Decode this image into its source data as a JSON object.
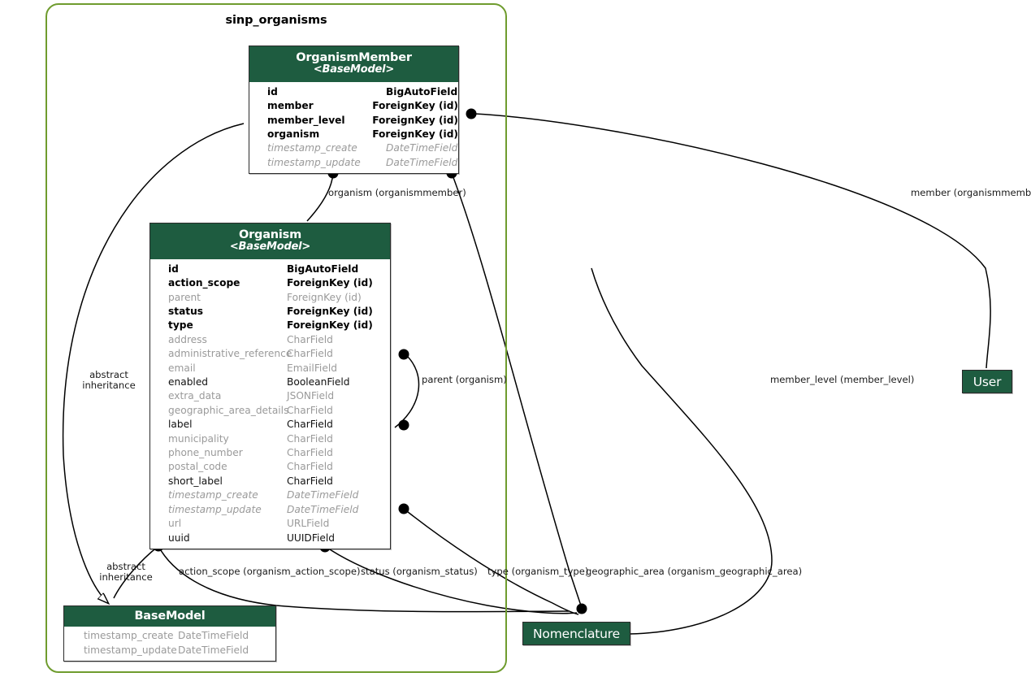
{
  "diagram": {
    "title": "sinp_organisms",
    "cluster_border_color": "#6f9c2e",
    "header_color": "#1e5c40",
    "node_text_color": "#ffffff",
    "edge_color": "#000000"
  },
  "models": [
    {
      "key": "organismmember",
      "name": "OrganismMember",
      "base": "<BaseModel>",
      "fields": [
        {
          "name": "id",
          "type": "BigAutoField",
          "style": "strong"
        },
        {
          "name": "member",
          "type": "ForeignKey (id)",
          "style": "strong"
        },
        {
          "name": "member_level",
          "type": "ForeignKey (id)",
          "style": "strong"
        },
        {
          "name": "organism",
          "type": "ForeignKey (id)",
          "style": "strong"
        },
        {
          "name": "timestamp_create",
          "type": "DateTimeField",
          "style": "italic"
        },
        {
          "name": "timestamp_update",
          "type": "DateTimeField",
          "style": "italic"
        }
      ]
    },
    {
      "key": "organism",
      "name": "Organism",
      "base": "<BaseModel>",
      "fields": [
        {
          "name": "id",
          "type": "BigAutoField",
          "style": "strong"
        },
        {
          "name": "action_scope",
          "type": "ForeignKey (id)",
          "style": "strong"
        },
        {
          "name": "parent",
          "type": "ForeignKey (id)",
          "style": "muted"
        },
        {
          "name": "status",
          "type": "ForeignKey (id)",
          "style": "strong"
        },
        {
          "name": "type",
          "type": "ForeignKey (id)",
          "style": "strong"
        },
        {
          "name": "address",
          "type": "CharField",
          "style": "muted"
        },
        {
          "name": "administrative_reference",
          "type": "CharField",
          "style": "muted"
        },
        {
          "name": "email",
          "type": "EmailField",
          "style": "muted"
        },
        {
          "name": "enabled",
          "type": "BooleanField",
          "style": "normal"
        },
        {
          "name": "extra_data",
          "type": "JSONField",
          "style": "muted"
        },
        {
          "name": "geographic_area_details",
          "type": "CharField",
          "style": "muted"
        },
        {
          "name": "label",
          "type": "CharField",
          "style": "normal"
        },
        {
          "name": "municipality",
          "type": "CharField",
          "style": "muted"
        },
        {
          "name": "phone_number",
          "type": "CharField",
          "style": "muted"
        },
        {
          "name": "postal_code",
          "type": "CharField",
          "style": "muted"
        },
        {
          "name": "short_label",
          "type": "CharField",
          "style": "normal"
        },
        {
          "name": "timestamp_create",
          "type": "DateTimeField",
          "style": "italic"
        },
        {
          "name": "timestamp_update",
          "type": "DateTimeField",
          "style": "italic"
        },
        {
          "name": "url",
          "type": "URLField",
          "style": "muted"
        },
        {
          "name": "uuid",
          "type": "UUIDField",
          "style": "normal"
        }
      ]
    },
    {
      "key": "basemodel",
      "name": "BaseModel",
      "base": "",
      "fields": [
        {
          "name": "timestamp_create",
          "type": "DateTimeField",
          "style": "muted"
        },
        {
          "name": "timestamp_update",
          "type": "DateTimeField",
          "style": "muted"
        }
      ]
    }
  ],
  "nodes": [
    {
      "key": "user",
      "label": "User"
    },
    {
      "key": "nomenclature",
      "label": "Nomenclature"
    }
  ],
  "edge_labels": [
    {
      "key": "organism_organismmember",
      "text": "organism (organismmember)"
    },
    {
      "key": "member_organismmember",
      "text": "member (organismmember)"
    },
    {
      "key": "member_level",
      "text": "member_level (member_level)"
    },
    {
      "key": "parent_organism",
      "text": "parent (organism)"
    },
    {
      "key": "abstract_inheritance_left",
      "line1": "abstract",
      "line2": "inheritance"
    },
    {
      "key": "abstract_inheritance_bottom",
      "line1": "abstract",
      "line2": "inheritance"
    },
    {
      "key": "action_scope",
      "text": "action_scope (organism_action_scope)"
    },
    {
      "key": "status",
      "text": "status (organism_status)"
    },
    {
      "key": "type",
      "text": "type (organism_type)"
    },
    {
      "key": "geographic_area",
      "text": "geographic_area (organism_geographic_area)"
    }
  ]
}
